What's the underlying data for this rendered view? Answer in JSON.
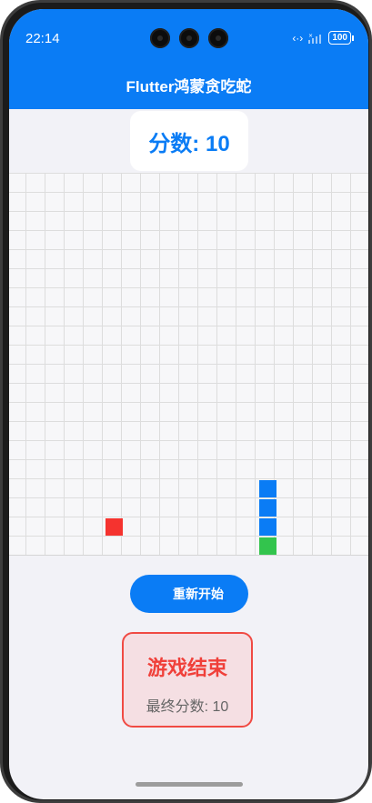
{
  "status_bar": {
    "time": "22:14",
    "battery": "100",
    "icons": [
      "camera-icon",
      "nfc-icon",
      "signal-icon",
      "battery-icon"
    ]
  },
  "app_bar": {
    "title": "Flutter鸿蒙贪吃蛇"
  },
  "score": {
    "label": "分数: 10"
  },
  "board": {
    "food_color": "#f5332f",
    "snake_body_color": "#0a7cf5",
    "snake_head_color": "#33c44d"
  },
  "controls": {
    "restart_label": "重新开始"
  },
  "game_over": {
    "title": "游戏结束",
    "final_score": "最终分数: 10"
  },
  "colors": {
    "primary": "#0a7cf5",
    "danger": "#f04a43",
    "background": "#f2f2f7"
  }
}
